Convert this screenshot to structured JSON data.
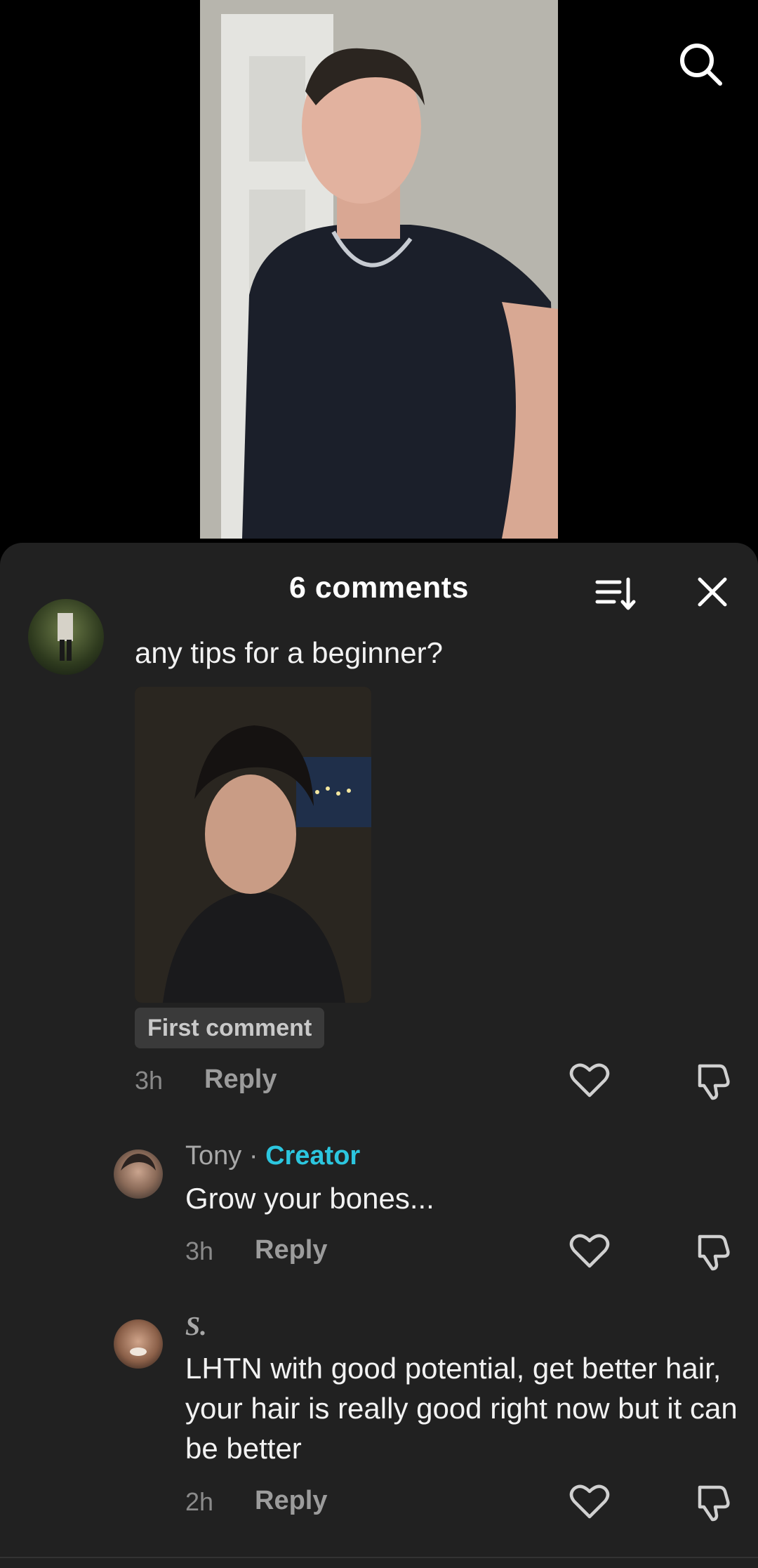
{
  "header": {
    "title": "6 comments",
    "icons": {
      "search": "search-icon",
      "sort": "sort-icon",
      "close": "close-icon"
    }
  },
  "comments": [
    {
      "text": "any tips for a beginner?",
      "badge": "First comment",
      "time": "3h",
      "reply_label": "Reply"
    },
    {
      "author": "Tony",
      "separator": "·",
      "role": "Creator",
      "text": "Grow your bones...",
      "time": "3h",
      "reply_label": "Reply"
    },
    {
      "author": "S.",
      "text": "LHTN with good potential, get better hair, your hair is really good right now but it can be better",
      "time": "2h",
      "reply_label": "Reply"
    }
  ],
  "colors": {
    "sheet_bg": "#212121",
    "creator_accent": "#2cc6df",
    "badge_bg": "#3a3a3a"
  }
}
